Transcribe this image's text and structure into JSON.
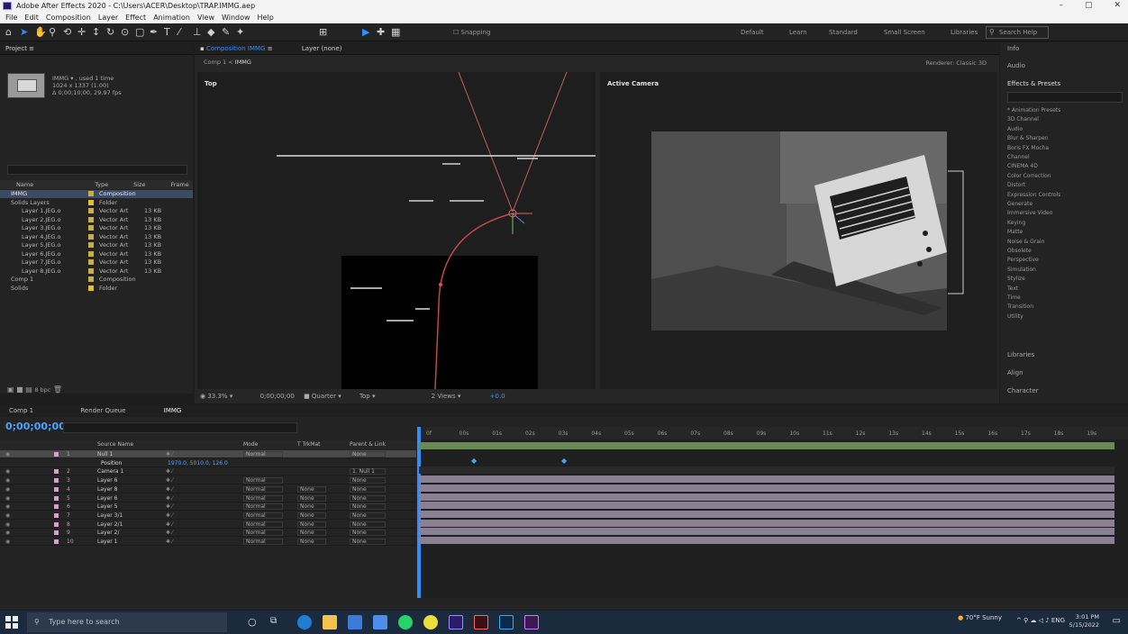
{
  "window": {
    "title": "Adobe After Effects 2020 - C:\\Users\\ACER\\Desktop\\TRAP.IMMG.aep",
    "controls": [
      "–",
      "▢",
      "✕"
    ]
  },
  "menu": [
    "File",
    "Edit",
    "Composition",
    "Layer",
    "Effect",
    "Animation",
    "View",
    "Window",
    "Help"
  ],
  "toolbar": {
    "snapping_label": "Snapping",
    "workspaces": [
      "Default",
      "Learn",
      "Standard",
      "Small Screen",
      "Libraries"
    ],
    "search_placeholder": "Search Help"
  },
  "project": {
    "tab": "Project",
    "comp_name": "IMMG ▾ , used 1 time",
    "comp_info_1": "1024 x 1337 (1.00)",
    "comp_info_2": "Δ 0;00;10;00, 29.97 fps",
    "columns": [
      "Name",
      "Type",
      "Size",
      "Frame"
    ],
    "items": [
      {
        "name": "IMMG",
        "type": "Composition",
        "color": "#c8b048",
        "selected": true
      },
      {
        "name": "Solids Layers",
        "type": "Folder",
        "color": "#e0c030"
      },
      {
        "name": "Layer 1.JEG.o",
        "type": "Vector Art",
        "size": "13 KB",
        "color": "#c8b048"
      },
      {
        "name": "Layer 2.JEG.o",
        "type": "Vector Art",
        "size": "13 KB",
        "color": "#c8b048"
      },
      {
        "name": "Layer 3.JEG.o",
        "type": "Vector Art",
        "size": "13 KB",
        "color": "#c8b048"
      },
      {
        "name": "Layer 4.JEG.o",
        "type": "Vector Art",
        "size": "13 KB",
        "color": "#c8b048"
      },
      {
        "name": "Layer 5.JEG.o",
        "type": "Vector Art",
        "size": "13 KB",
        "color": "#c8b048"
      },
      {
        "name": "Layer 6.JEG.o",
        "type": "Vector Art",
        "size": "13 KB",
        "color": "#c8b048"
      },
      {
        "name": "Layer 7.JEG.o",
        "type": "Vector Art",
        "size": "13 KB",
        "color": "#c8b048"
      },
      {
        "name": "Layer 8.JEG.o",
        "type": "Vector Art",
        "size": "13 KB",
        "color": "#c8b048"
      },
      {
        "name": "Comp 1",
        "type": "Composition",
        "color": "#c8b048"
      },
      {
        "name": "Solids",
        "type": "Folder",
        "color": "#e0c030"
      }
    ],
    "bpc": "8 bpc"
  },
  "composition": {
    "tab": "Composition IMMG",
    "layer_tab": "Layer (none)",
    "sub_tabs": [
      "Comp 1",
      "IMMG"
    ],
    "renderer": "Renderer: Classic 3D",
    "left_view_label": "Top",
    "right_view_label": "Active Camera",
    "footer": {
      "zoom": "33.3%",
      "timecode": "0;00;00;00",
      "resolution": "Quarter",
      "view": "Top",
      "views": "2 Views",
      "exposure": "+0.0"
    }
  },
  "right_panels": {
    "items": [
      "Info",
      "Audio"
    ],
    "effects_title": "Effects & Presets",
    "effects_search_placeholder": "",
    "effects": [
      "* Animation Presets",
      "3D Channel",
      "Audio",
      "Blur & Sharpen",
      "Boris FX Mocha",
      "Channel",
      "CINEMA 4D",
      "Color Correction",
      "Distort",
      "Expression Controls",
      "Generate",
      "Immersive Video",
      "Keying",
      "Matte",
      "Noise & Grain",
      "Obsolete",
      "Perspective",
      "Simulation",
      "Stylize",
      "Text",
      "Time",
      "Transition",
      "Utility"
    ],
    "bottom": [
      "Libraries",
      "Align",
      "Character"
    ]
  },
  "timeline": {
    "tabs": [
      "Comp 1",
      "Render Queue",
      "IMMG"
    ],
    "timecode": "0;00;00;00",
    "columns": [
      "Source Name",
      "Mode",
      "T TrkMat",
      "Parent & Link"
    ],
    "layers": [
      {
        "num": "1",
        "name": "Null 1",
        "mode": "Normal",
        "matte": "",
        "parent": "None",
        "selected": true
      },
      {
        "num": "",
        "name": "Position",
        "mode": "",
        "matte": "",
        "parent": "",
        "sub": true,
        "value": "1970.0, 5010.0, 126.0"
      },
      {
        "num": "2",
        "name": "Camera 1",
        "mode": "",
        "matte": "",
        "parent": "1. Null 1"
      },
      {
        "num": "3",
        "name": "Layer 6",
        "mode": "Normal",
        "matte": "",
        "parent": "None"
      },
      {
        "num": "4",
        "name": "Layer 8",
        "mode": "Normal",
        "matte": "None",
        "parent": "None"
      },
      {
        "num": "5",
        "name": "Layer 6",
        "mode": "Normal",
        "matte": "None",
        "parent": "None"
      },
      {
        "num": "6",
        "name": "Layer 5",
        "mode": "Normal",
        "matte": "None",
        "parent": "None"
      },
      {
        "num": "7",
        "name": "Layer 3/1",
        "mode": "Normal",
        "matte": "None",
        "parent": "None"
      },
      {
        "num": "8",
        "name": "Layer 2/1",
        "mode": "Normal",
        "matte": "None",
        "parent": "None"
      },
      {
        "num": "9",
        "name": "Layer 2/",
        "mode": "Normal",
        "matte": "None",
        "parent": "None"
      },
      {
        "num": "10",
        "name": "Layer 1",
        "mode": "Normal",
        "matte": "None",
        "parent": "None"
      }
    ],
    "ruler_ticks": [
      "0f",
      "00s",
      "01s",
      "02s",
      "03s",
      "04s",
      "05s",
      "06s",
      "07s",
      "08s",
      "09s",
      "10s",
      "11s",
      "12s",
      "13s",
      "14s",
      "15s",
      "16s",
      "17s",
      "18s",
      "19s"
    ]
  },
  "taskbar": {
    "search_placeholder": "Type here to search",
    "weather": "70°F Sunny",
    "time": "3:01 PM",
    "date": "5/15/2022"
  }
}
